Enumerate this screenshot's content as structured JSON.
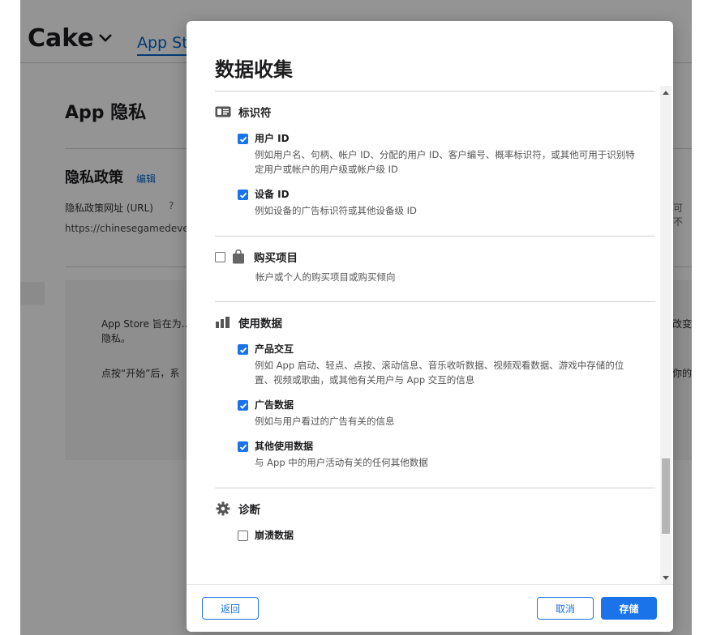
{
  "background": {
    "app_name": "Cake",
    "tab_label": "App St",
    "page_title": "App 隐私",
    "policy_title": "隐私政策",
    "policy_edit": "编辑",
    "policy_url_label": "隐私政策网址 (URL)",
    "help_glyph": "?",
    "policy_url": "https://chinesegamedeve",
    "right_snippet": "可不",
    "info_text_1": "App Store 旨在为...隐私。",
    "info_text_2": "点按“开始”后，系",
    "info_right_1": "改变",
    "info_right_2": "l你的"
  },
  "modal": {
    "title": "数据收集",
    "categories": [
      {
        "label": "标识符",
        "icon": "id-card-icon",
        "items": [
          {
            "title": "用户 ID",
            "checked": true,
            "desc": "例如用户名、句柄、帐户 ID、分配的用户 ID、客户编号、概率标识符，或其他可用于识别特定用户或帐户的用户级或帐户级 ID"
          },
          {
            "title": "设备 ID",
            "checked": true,
            "desc": "例如设备的广告标识符或其他设备级 ID"
          }
        ]
      },
      {
        "label": "购买项目",
        "icon": "shopping-bag-icon",
        "checked": false,
        "desc": "帐户或个人的购买项目或购买倾向"
      },
      {
        "label": "使用数据",
        "icon": "bar-chart-icon",
        "items": [
          {
            "title": "产品交互",
            "checked": true,
            "desc": "例如 App 启动、轻点、点按、滚动信息、音乐收听数据、视频观看数据、游戏中存储的位置、视频或歌曲，或其他有关用户与 App 交互的信息"
          },
          {
            "title": "广告数据",
            "checked": true,
            "desc": "例如与用户看过的广告有关的信息"
          },
          {
            "title": "其他使用数据",
            "checked": true,
            "desc": "与 App 中的用户活动有关的任何其他数据"
          }
        ]
      },
      {
        "label": "诊断",
        "icon": "gear-icon",
        "items": [
          {
            "title": "崩溃数据",
            "checked": false,
            "desc": ""
          }
        ]
      }
    ],
    "buttons": {
      "back": "返回",
      "cancel": "取消",
      "save": "存储"
    }
  },
  "colors": {
    "accent": "#1a73e8",
    "link": "#0066cc"
  }
}
